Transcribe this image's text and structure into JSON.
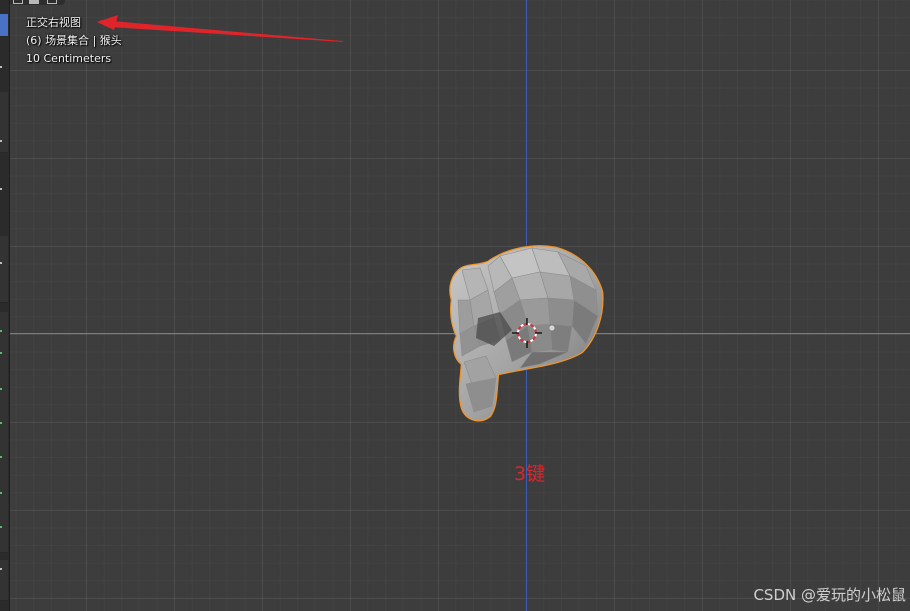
{
  "viewport": {
    "view_name": "正交右视图",
    "collection_line": "(6) 场景集合 | 猴头",
    "scale_text": "10 Centimeters"
  },
  "annotation": {
    "key_hint": "3键",
    "arrow_color": "#e0242a"
  },
  "colors": {
    "background": "#3d3d3d",
    "x_axis": "#6f8f3c",
    "z_axis": "#3a5db8",
    "selection_outline": "#f0952a",
    "mesh": "#a9a9a9"
  },
  "watermark": "CSDN @爱玩的小松鼠"
}
